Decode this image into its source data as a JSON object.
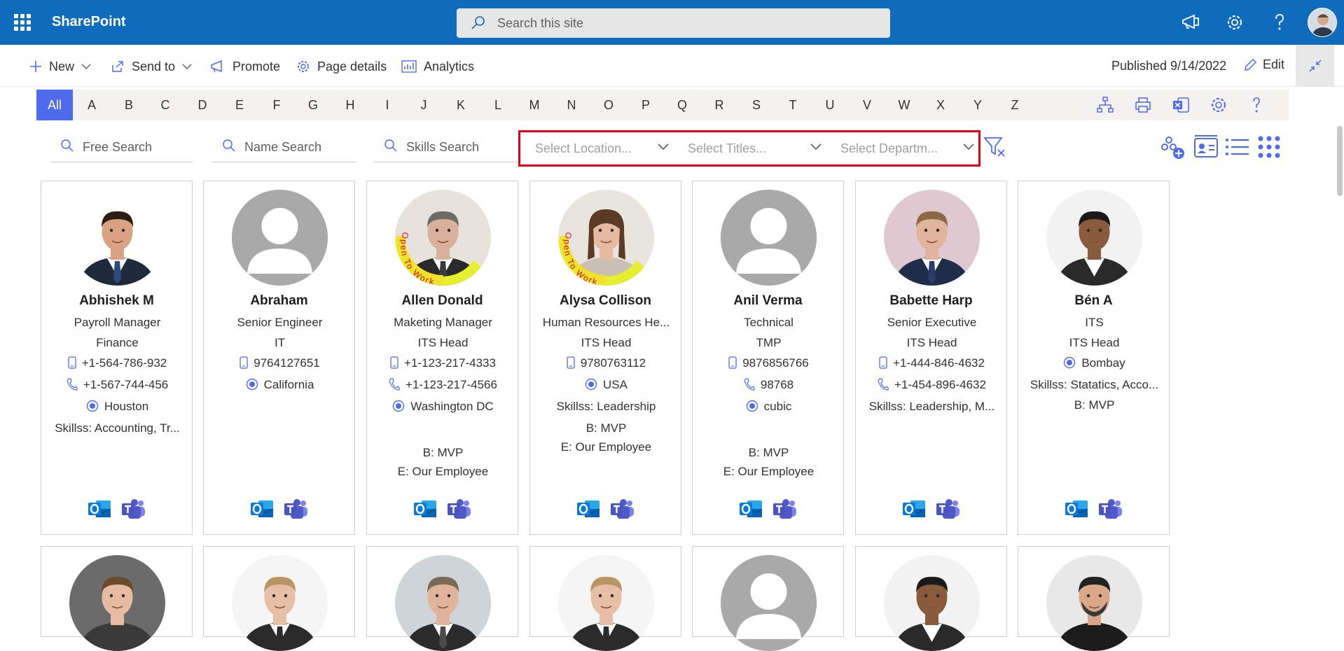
{
  "suite": {
    "brand": "SharePoint",
    "search_placeholder": "Search this site"
  },
  "commands": {
    "new": "New",
    "send_to": "Send to",
    "promote": "Promote",
    "page_details": "Page details",
    "analytics": "Analytics",
    "published": "Published 9/14/2022",
    "edit": "Edit"
  },
  "alphabet": [
    "All",
    "A",
    "B",
    "C",
    "D",
    "E",
    "F",
    "G",
    "H",
    "I",
    "J",
    "K",
    "L",
    "M",
    "N",
    "O",
    "P",
    "Q",
    "R",
    "S",
    "T",
    "U",
    "V",
    "W",
    "X",
    "Y",
    "Z"
  ],
  "filters": {
    "free_search": "Free Search",
    "name_search": "Name Search",
    "skills_search": "Skills Search",
    "location": "Select Location...",
    "titles": "Select Titles...",
    "department": "Select Departm..."
  },
  "open_to_work_text": "Open To Work",
  "accent_color": "#4f6bed",
  "brand_color": "#0f6cbd",
  "people": [
    {
      "name": "Abhishek M",
      "title": "Payroll Manager",
      "dept": "Finance",
      "mobile": "+1-564-786-932",
      "phone": "+1-567-744-456",
      "location": "Houston",
      "skills": "Skillss: Accounting, Tr...",
      "b": "",
      "e": "",
      "photo": "man-suit",
      "open_to_work": false
    },
    {
      "name": "Abraham",
      "title": "Senior Engineer",
      "dept": "IT",
      "mobile": "9764127651",
      "phone": "",
      "location": "California",
      "skills": "",
      "b": "",
      "e": "",
      "photo": "default",
      "open_to_work": false
    },
    {
      "name": "Allen Donald",
      "title": "Maketing Manager",
      "dept": "ITS Head",
      "mobile": "+1-123-217-4333",
      "phone": "+1-123-217-4566",
      "location": "Washington DC",
      "skills": "",
      "b": "B: MVP",
      "e": "E: Our Employee",
      "photo": "man-grey",
      "open_to_work": true
    },
    {
      "name": "Alysa Collison",
      "title": "Human Resources He...",
      "dept": "ITS Head",
      "mobile": "9780763112",
      "phone": "",
      "location": "USA",
      "skills": "Skillss: Leadership",
      "b": "B: MVP",
      "e": "E: Our Employee",
      "photo": "woman",
      "open_to_work": true
    },
    {
      "name": "Anil Verma",
      "title": "Technical",
      "dept": "TMP",
      "mobile": "9876856766",
      "phone": "98768",
      "location": "cubic",
      "skills": "",
      "b": "B: MVP",
      "e": "E: Our Employee",
      "photo": "default",
      "open_to_work": false
    },
    {
      "name": "Babette Harp",
      "title": "Senior Executive",
      "dept": "ITS Head",
      "mobile": "+1-444-846-4632",
      "phone": "+1-454-896-4632",
      "location": "",
      "skills": "Skillss: Leadership, M...",
      "b": "",
      "e": "",
      "photo": "man-navy",
      "open_to_work": false
    },
    {
      "name": "Bén A",
      "title": "ITS",
      "dept": "ITS Head",
      "mobile": "",
      "phone": "",
      "location": "Bombay",
      "skills": "Skillss: Statatics, Acco...",
      "b": "B: MVP",
      "e": "",
      "photo": "man-dark",
      "open_to_work": false
    }
  ],
  "people_row2": [
    {
      "photo": "boy"
    },
    {
      "photo": "man-blond"
    },
    {
      "photo": "man-office"
    },
    {
      "photo": "man-blond"
    },
    {
      "photo": "default"
    },
    {
      "photo": "man-dark"
    },
    {
      "photo": "man-beard"
    }
  ]
}
